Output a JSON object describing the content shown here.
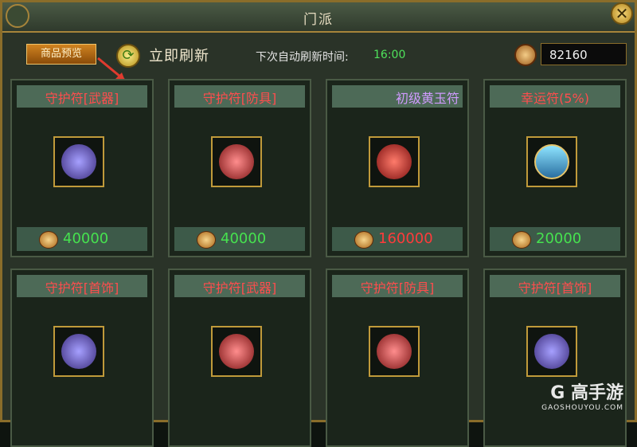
{
  "window": {
    "title": "门派"
  },
  "toolbar": {
    "preview_label": "商品预览",
    "refresh_label": "立即刷新",
    "timer_label": "下次自动刷新时间:",
    "timer_value": "16:00",
    "gold_amount": "82160"
  },
  "items": [
    {
      "name": "守护符[武器]",
      "name_color": "red",
      "icon": "purple-orb-icon",
      "price": "40000",
      "price_color": "green"
    },
    {
      "name": "守护符[防具]",
      "name_color": "red",
      "icon": "red-orb-icon",
      "price": "40000",
      "price_color": "green"
    },
    {
      "name": "初级黄玉符",
      "name_color": "purple",
      "icon": "red-diamond-icon",
      "price": "160000",
      "price_color": "red"
    },
    {
      "name": "幸运符(5%)",
      "name_color": "red",
      "icon": "luck-scroll-icon",
      "price": "20000",
      "price_color": "green"
    },
    {
      "name": "守护符[首饰]",
      "name_color": "red",
      "icon": "purple-orb-icon"
    },
    {
      "name": "守护符[武器]",
      "name_color": "red",
      "icon": "red-orb-icon"
    },
    {
      "name": "守护符[防具]",
      "name_color": "red",
      "icon": "red-orb-icon"
    },
    {
      "name": "守护符[首饰]",
      "name_color": "red",
      "icon": "purple-orb-icon"
    }
  ],
  "watermark": {
    "logo": "G 高手游",
    "sub": "GAOSHOUYOU.COM"
  },
  "colors": {
    "frame_gold": "#a6843a",
    "name_red": "#ff4d4d",
    "name_purple": "#d09bff",
    "price_green": "#46e24f",
    "price_red": "#ff3b3b"
  }
}
